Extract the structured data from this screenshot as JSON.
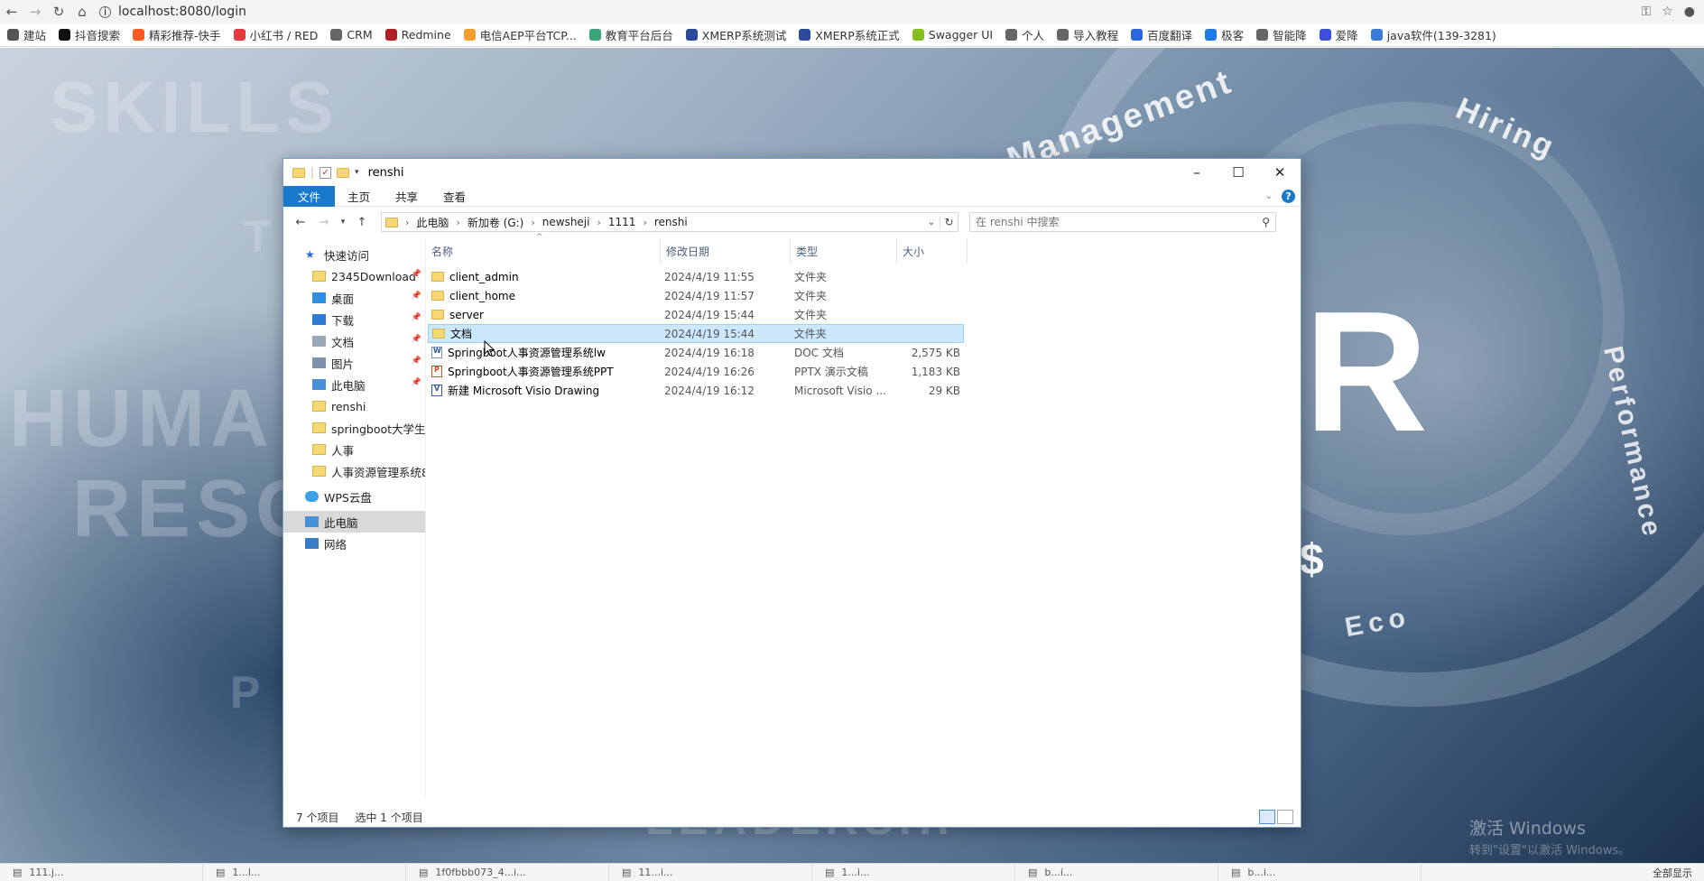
{
  "browser": {
    "url": "localhost:8080/login",
    "bookmarks": [
      {
        "label": "建站",
        "color": "#555555"
      },
      {
        "label": "抖音搜索",
        "color": "#111111"
      },
      {
        "label": "精彩推荐-快手",
        "color": "#ff5a1f"
      },
      {
        "label": "小红书 / RED",
        "color": "#e4393c"
      },
      {
        "label": "CRM",
        "color": "#666666"
      },
      {
        "label": "Redmine",
        "color": "#b32024"
      },
      {
        "label": "电信AEP平台TCP...",
        "color": "#f0a030"
      },
      {
        "label": "教育平台后台",
        "color": "#3aa57a"
      },
      {
        "label": "XMERP系统测试",
        "color": "#2c4a9a"
      },
      {
        "label": "XMERP系统正式",
        "color": "#2c4a9a"
      },
      {
        "label": "Swagger UI",
        "color": "#85c01e"
      },
      {
        "label": "个人",
        "color": "#666666"
      },
      {
        "label": "导入教程",
        "color": "#666666"
      },
      {
        "label": "百度翻译",
        "color": "#2b66dd"
      },
      {
        "label": "极客",
        "color": "#1e7be4"
      },
      {
        "label": "智能降",
        "color": "#666666"
      },
      {
        "label": "爱降",
        "color": "#3b4fd8"
      },
      {
        "label": "java软件(139-3281)",
        "color": "#3a7bd5"
      }
    ]
  },
  "background": {
    "words": [
      "SKILLS",
      "HUMA",
      "RESO",
      "Management",
      "Hiring",
      "Performance",
      "LEADERSHI",
      "P",
      "Eco",
      "T"
    ],
    "letter": "R",
    "dollar": "$",
    "watermark_line1": "激活 Windows",
    "watermark_line2": "转到\"设置\"以激活 Windows。"
  },
  "window": {
    "title": "renshi",
    "ribbon_tabs": [
      "文件",
      "主页",
      "共享",
      "查看"
    ],
    "breadcrumb": [
      "此电脑",
      "新加卷 (G:)",
      "newsheji",
      "1111",
      "renshi"
    ],
    "search_placeholder": "在 renshi 中搜索",
    "nav_pane": [
      {
        "label": "快速访问",
        "icon": "star-icon",
        "level": 0,
        "pinned": false
      },
      {
        "label": "2345Download",
        "icon": "folder-icon",
        "level": 1,
        "pinned": true
      },
      {
        "label": "桌面",
        "icon": "desktop-icon",
        "level": 1,
        "pinned": true
      },
      {
        "label": "下载",
        "icon": "download-icon",
        "level": 1,
        "pinned": true
      },
      {
        "label": "文档",
        "icon": "document-icon",
        "level": 1,
        "pinned": true
      },
      {
        "label": "图片",
        "icon": "picture-icon",
        "level": 1,
        "pinned": true
      },
      {
        "label": "此电脑",
        "icon": "computer-icon",
        "level": 1,
        "pinned": true
      },
      {
        "label": "renshi",
        "icon": "folder-icon",
        "level": 1,
        "pinned": false
      },
      {
        "label": "springboot大学生:",
        "icon": "folder-icon",
        "level": 1,
        "pinned": false
      },
      {
        "label": "人事",
        "icon": "folder-icon",
        "level": 1,
        "pinned": false
      },
      {
        "label": "人事资源管理系统8",
        "icon": "folder-icon",
        "level": 1,
        "pinned": false
      },
      {
        "label": "WPS云盘",
        "icon": "cloud-icon",
        "level": 0,
        "pinned": false
      },
      {
        "label": "此电脑",
        "icon": "computer-icon",
        "level": 0,
        "pinned": false,
        "selected": true
      },
      {
        "label": "网络",
        "icon": "network-icon",
        "level": 0,
        "pinned": false
      }
    ],
    "columns": [
      "名称",
      "修改日期",
      "类型",
      "大小"
    ],
    "files": [
      {
        "name": "client_admin",
        "date": "2024/4/19 11:55",
        "type": "文件夹",
        "size": "",
        "icon": "folder"
      },
      {
        "name": "client_home",
        "date": "2024/4/19 11:57",
        "type": "文件夹",
        "size": "",
        "icon": "folder"
      },
      {
        "name": "server",
        "date": "2024/4/19 15:44",
        "type": "文件夹",
        "size": "",
        "icon": "folder"
      },
      {
        "name": "文档",
        "date": "2024/4/19 15:44",
        "type": "文件夹",
        "size": "",
        "icon": "folder",
        "selected": true
      },
      {
        "name": "Springboot人事资源管理系统lw",
        "date": "2024/4/19 16:18",
        "type": "DOC 文档",
        "size": "2,575 KB",
        "icon": "doc"
      },
      {
        "name": "Springboot人事资源管理系统PPT",
        "date": "2024/4/19 16:26",
        "type": "PPTX 演示文稿",
        "size": "1,183 KB",
        "icon": "ppt"
      },
      {
        "name": "新建 Microsoft Visio Drawing",
        "date": "2024/4/19 16:12",
        "type": "Microsoft Visio ...",
        "size": "29 KB",
        "icon": "vsd"
      }
    ],
    "status_count": "7 个项目",
    "status_selected": "选中 1 个项目"
  },
  "taskbar": {
    "items": [
      "111.j...",
      "1...l...",
      "1f0fbbb073_4...i...",
      "11...i...",
      "1...i...",
      "b...i...",
      "b...i..."
    ],
    "right_label": "全部显示"
  }
}
